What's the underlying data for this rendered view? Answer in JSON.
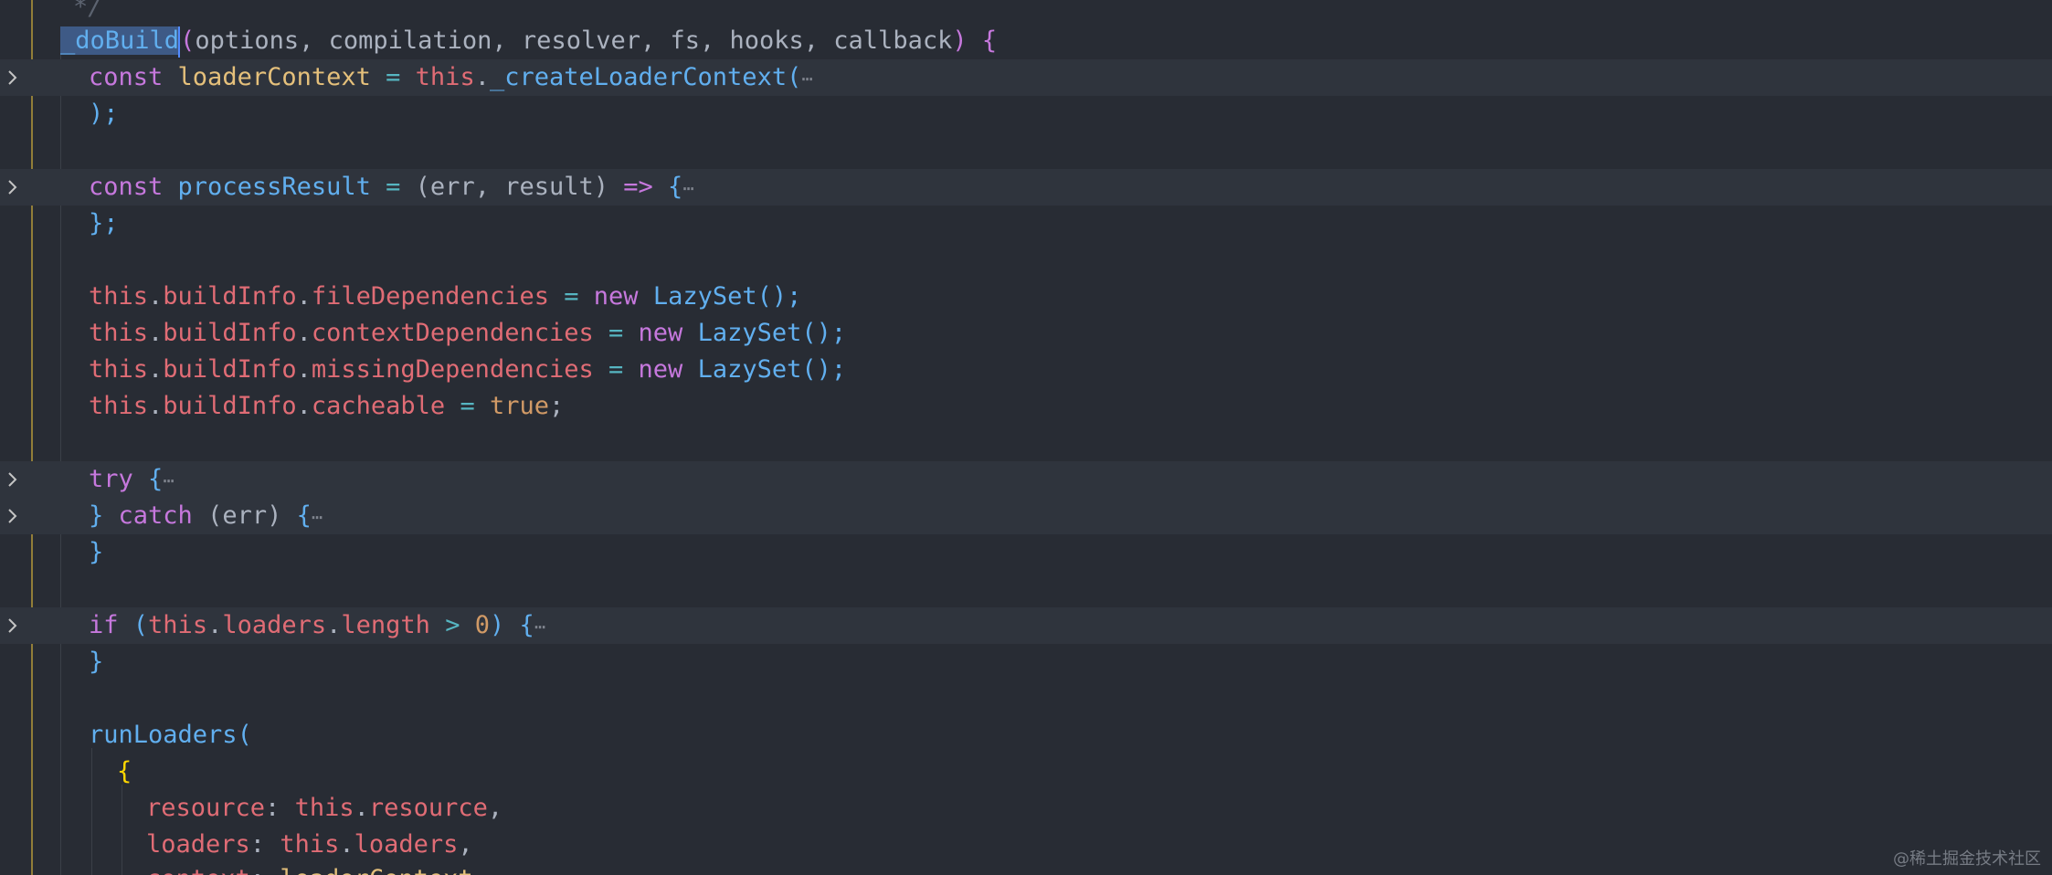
{
  "editor": {
    "lines": {
      "l0": {
        "comment": "*/"
      },
      "l1": {
        "name": "_doBuild",
        "paren_open": "(",
        "params": "options, compilation, resolver, fs, hooks, callback",
        "paren_close": ")",
        "brace": " {"
      },
      "l2": {
        "kw": "const",
        "var": "loaderContext",
        "op": "=",
        "this": "this",
        "dot": ".",
        "method": "_createLoaderContext",
        "paren": "(",
        "ellipsis": "⋯"
      },
      "l3": {
        "text": ");"
      },
      "l5": {
        "kw": "const",
        "var": "processResult",
        "op": "=",
        "args": "(err, result)",
        "arrow": "=>",
        "brace": "{",
        "ellipsis": "⋯"
      },
      "l6": {
        "text": "};"
      },
      "l8": {
        "this": "this",
        "prop1": "buildInfo",
        "prop2": "fileDependencies",
        "op": "=",
        "kw": "new",
        "cls": "LazySet",
        "call": "();"
      },
      "l9": {
        "this": "this",
        "prop1": "buildInfo",
        "prop2": "contextDependencies",
        "op": "=",
        "kw": "new",
        "cls": "LazySet",
        "call": "();"
      },
      "l10": {
        "this": "this",
        "prop1": "buildInfo",
        "prop2": "missingDependencies",
        "op": "=",
        "kw": "new",
        "cls": "LazySet",
        "call": "();"
      },
      "l11": {
        "this": "this",
        "prop1": "buildInfo",
        "prop2": "cacheable",
        "op": "=",
        "val": "true",
        "semi": ";"
      },
      "l13": {
        "kw": "try",
        "brace": "{",
        "ellipsis": "⋯"
      },
      "l14": {
        "close": "}",
        "kw": "catch",
        "args": "(err)",
        "brace": "{",
        "ellipsis": "⋯"
      },
      "l15": {
        "text": "}"
      },
      "l17": {
        "kw": "if",
        "paren_open": "(",
        "this": "this",
        "prop1": "loaders",
        "prop2": "length",
        "op": ">",
        "num": "0",
        "paren_close": ")",
        "brace": "{",
        "ellipsis": "⋯"
      },
      "l18": {
        "text": "}"
      },
      "l20": {
        "fn": "runLoaders",
        "paren": "("
      },
      "l21": {
        "brace": "{"
      },
      "l22": {
        "key": "resource",
        "colon": ":",
        "this": "this",
        "prop": "resource",
        "comma": ","
      },
      "l23": {
        "key": "loaders",
        "colon": ":",
        "this": "this",
        "prop": "loaders",
        "comma": ","
      },
      "l24": {
        "key": "context",
        "colon": ":",
        "val": "loaderContext",
        "comma": ","
      }
    }
  },
  "watermark": {
    "text": "@稀土掘金技术社区"
  },
  "colors": {
    "background": "#282c34",
    "keyword": "#c678dd",
    "function": "#61afef",
    "property": "#e06c75",
    "variable": "#e5c07b",
    "number": "#d19a66",
    "operator": "#56b6c2",
    "gutter_border": "#b59a3a"
  },
  "icons": {
    "fold": "chevron-right-icon"
  }
}
